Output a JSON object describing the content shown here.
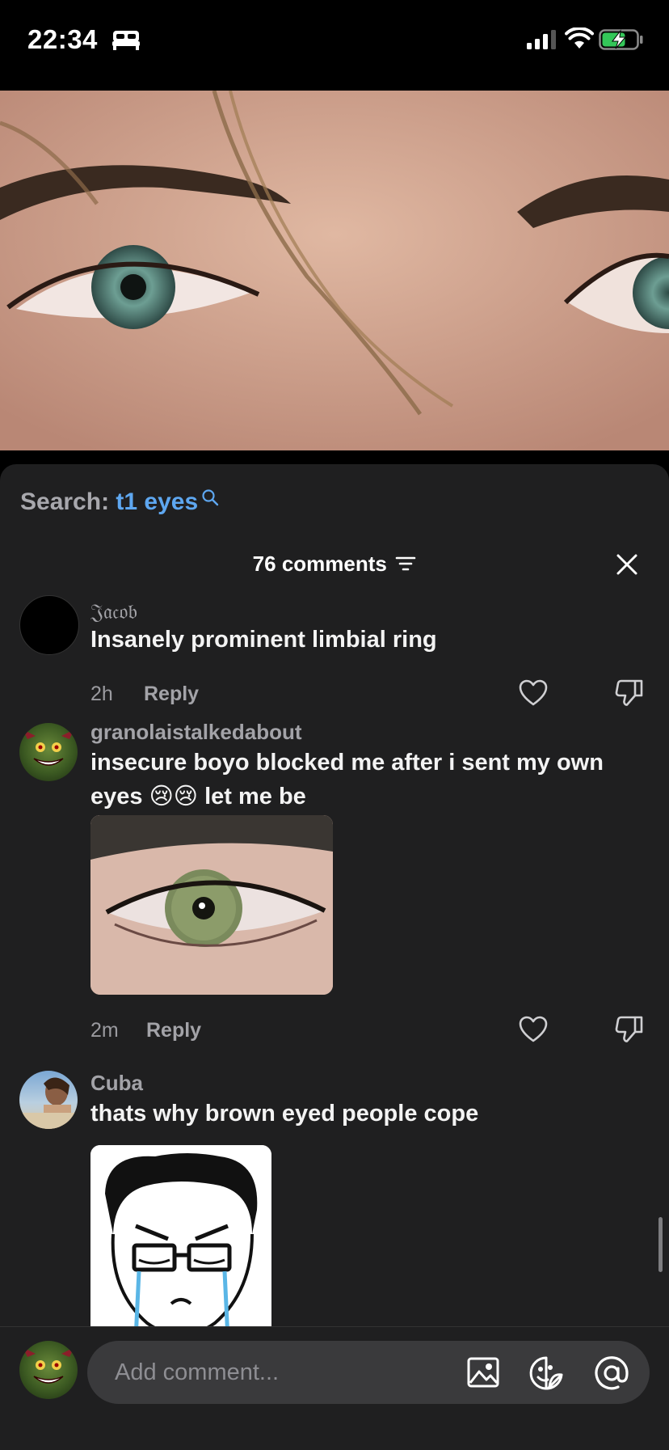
{
  "status_bar": {
    "time": "22:34"
  },
  "search": {
    "label": "Search:",
    "term": "t1 eyes"
  },
  "comments_header": {
    "count_label": "76 comments"
  },
  "comments": [
    {
      "username": "𝔍𝔞𝔠𝔬𝔟",
      "text": "Insanely prominent limbial ring",
      "time": "2h",
      "reply_label": "Reply"
    },
    {
      "username": "granolaistalkedabout",
      "text": "insecure boyo blocked me after i sent my own eyes 😢😢 let me be",
      "time": "2m",
      "reply_label": "Reply"
    },
    {
      "username": "Cuba",
      "text": "thats why brown eyed people cope"
    }
  ],
  "composer": {
    "placeholder": "Add comment..."
  },
  "colors": {
    "accent_search": "#5ea7f0",
    "sheet_bg": "#1f1f20",
    "input_bg": "#3a3a3c"
  }
}
